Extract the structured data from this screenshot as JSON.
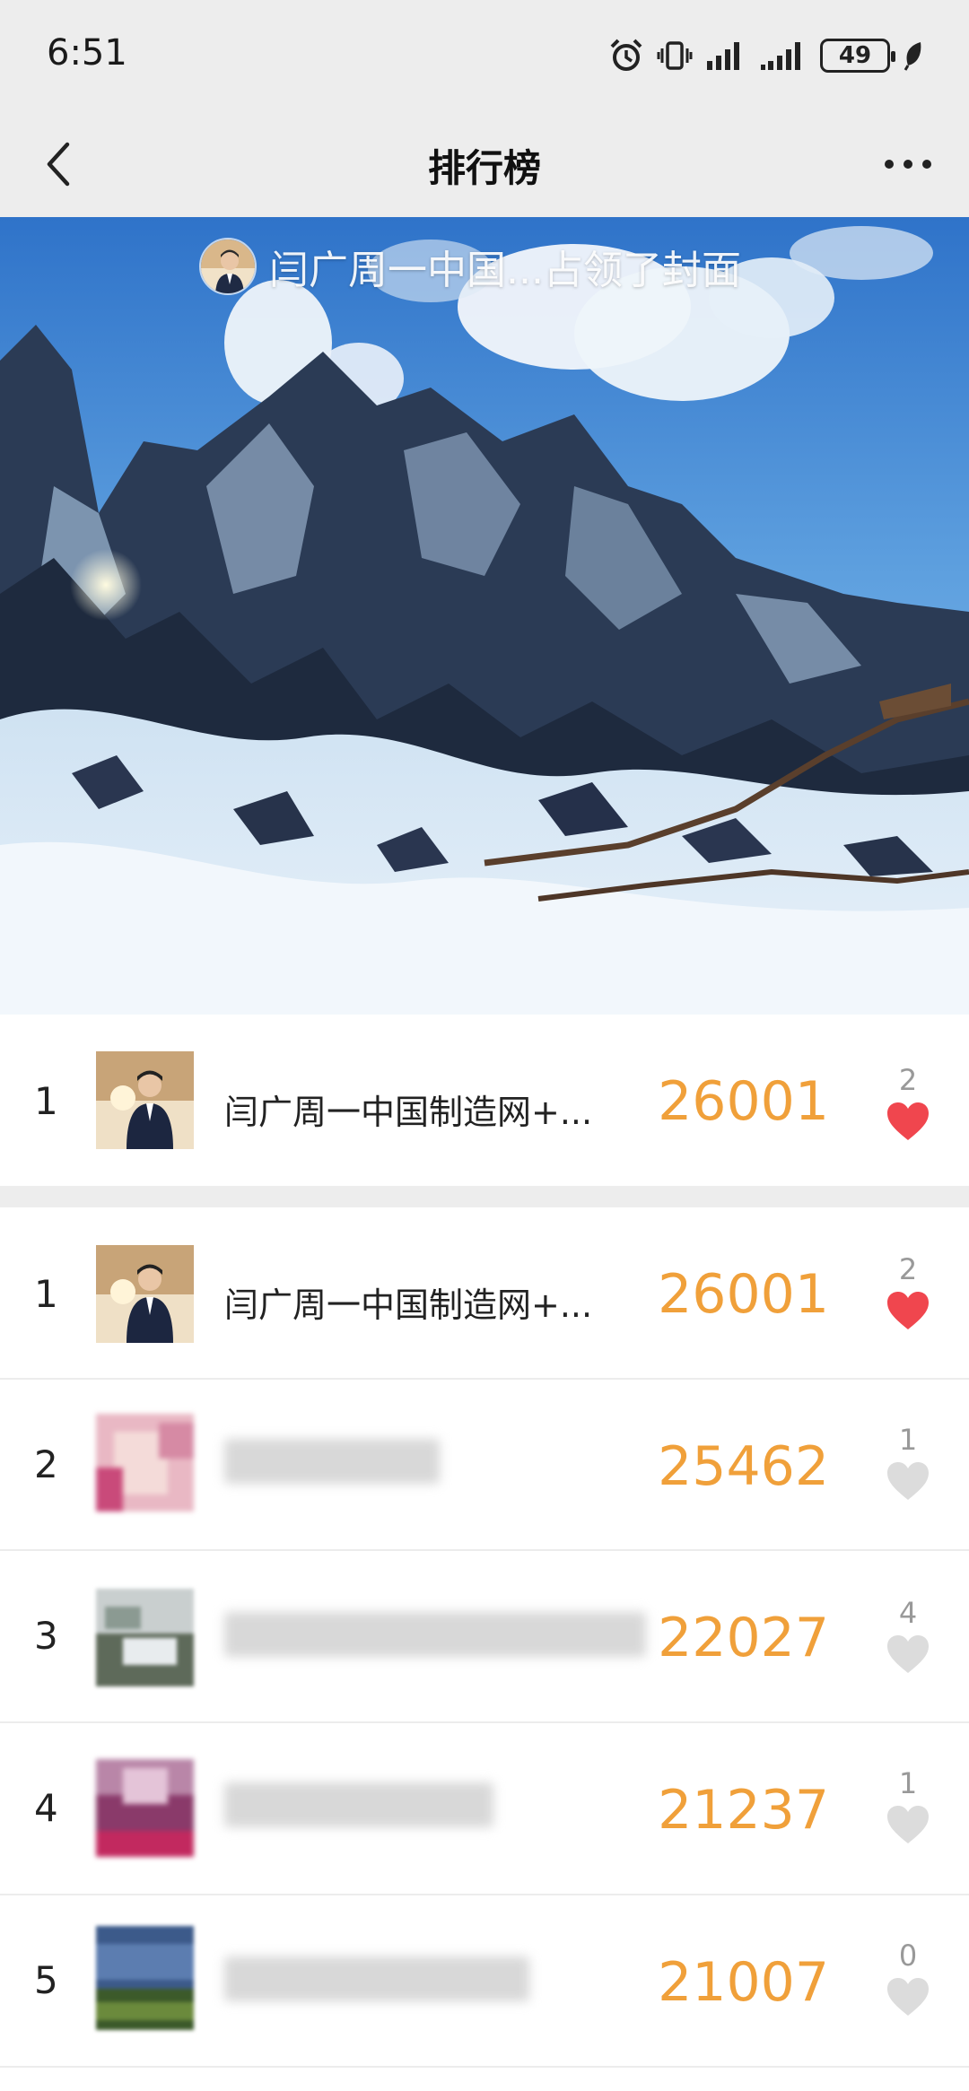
{
  "status": {
    "time": "6:51",
    "battery": "49"
  },
  "nav": {
    "title": "排行榜"
  },
  "cover": {
    "caption": "闫广周一中国...占领了封面"
  },
  "my_rank": {
    "rank": "1",
    "name": "闫广周一中国制造网+...",
    "score": "26001",
    "likes": "2",
    "liked": true
  },
  "leaderboard": [
    {
      "rank": "1",
      "name": "闫广周一中国制造网+...",
      "score": "26001",
      "likes": "2",
      "liked": true
    },
    {
      "rank": "2",
      "name": "",
      "score": "25462",
      "likes": "1",
      "liked": false
    },
    {
      "rank": "3",
      "name": "",
      "score": "22027",
      "likes": "4",
      "liked": false
    },
    {
      "rank": "4",
      "name": "",
      "score": "21237",
      "likes": "1",
      "liked": false
    },
    {
      "rank": "5",
      "name": "",
      "score": "21007",
      "likes": "0",
      "liked": false
    }
  ],
  "colors": {
    "score": "#f0a03a",
    "liked_heart": "#f0464e",
    "unliked_heart": "#dcdcdc",
    "bar_bg": "#ededed"
  }
}
